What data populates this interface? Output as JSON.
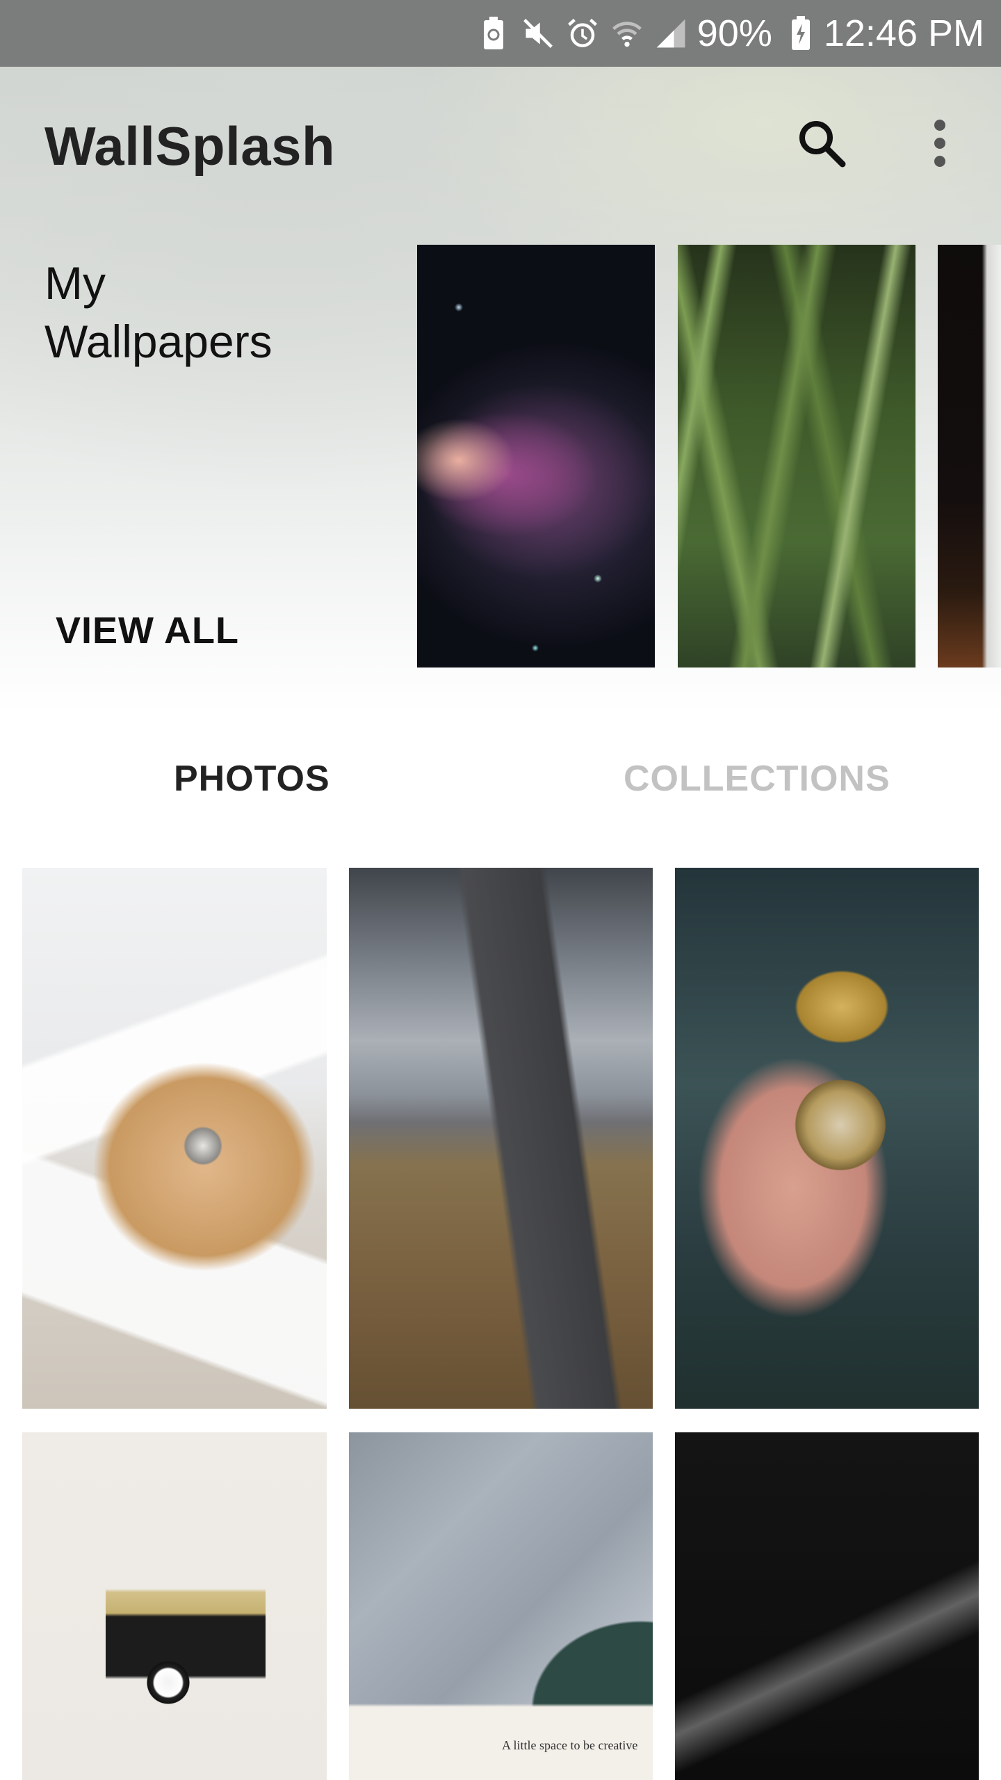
{
  "status_bar": {
    "battery_percent": "90%",
    "time": "12:46 PM",
    "icons": [
      "battery-saver-icon",
      "mute-icon",
      "alarm-icon",
      "wifi-icon",
      "signal-icon",
      "battery-charging-icon"
    ]
  },
  "app_bar": {
    "title": "WallSplash",
    "icons": [
      "search-icon",
      "more-vert-icon"
    ]
  },
  "my_wallpapers": {
    "heading_line1": "My",
    "heading_line2": "Wallpapers",
    "view_all_label": "VIEW ALL",
    "thumbnails": [
      "orion nebula in starfield",
      "green grass blades",
      "dark image with sparks"
    ]
  },
  "tabs": [
    {
      "label": "PHOTOS",
      "selected": true
    },
    {
      "label": "COLLECTIONS",
      "selected": false
    }
  ],
  "photos": [
    {
      "subject": "white chairs and round wooden side table with coffee cup"
    },
    {
      "subject": "coastal road under cloudy sky"
    },
    {
      "subject": "hand holding a brass compass"
    },
    {
      "subject": "vintage camera parts flat lay"
    },
    {
      "subject": "grey bedsheets with open book",
      "caption": "A little space to be creative"
    },
    {
      "subject": "boat wake on dark water"
    }
  ],
  "colors": {
    "status_bar": "#7b7d7c",
    "title_text": "#222222",
    "tab_active": "#222222",
    "tab_inactive": "#c2c2c2"
  }
}
